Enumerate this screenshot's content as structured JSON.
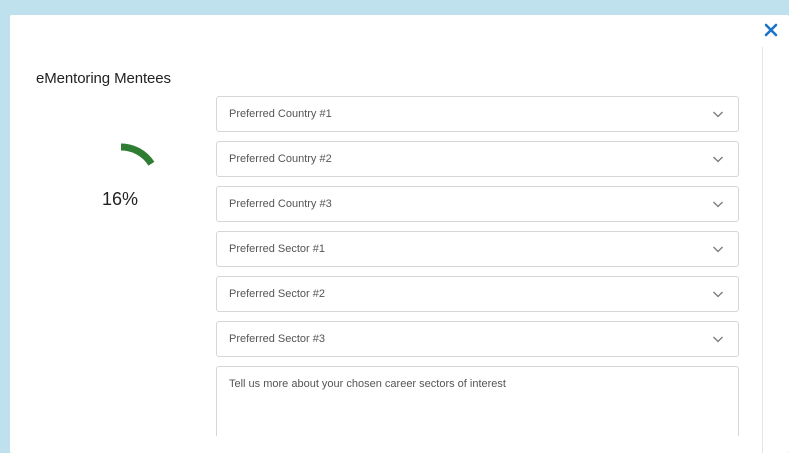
{
  "dialog": {
    "title": "eMentoring Mentees",
    "close_icon": "close-icon",
    "accent_color": "#1a73c8"
  },
  "progress": {
    "percent": 16,
    "label": "16%",
    "color": "#2e7d32"
  },
  "form": {
    "fields": [
      {
        "placeholder": "Preferred Country #1",
        "icon": "chevron-down-icon"
      },
      {
        "placeholder": "Preferred Country #2",
        "icon": "chevron-down-icon"
      },
      {
        "placeholder": "Preferred Country #3",
        "icon": "chevron-down-icon"
      },
      {
        "placeholder": "Preferred Sector #1",
        "icon": "chevron-down-icon"
      },
      {
        "placeholder": "Preferred Sector #2",
        "icon": "chevron-down-icon"
      },
      {
        "placeholder": "Preferred Sector #3",
        "icon": "chevron-down-icon"
      }
    ],
    "textarea_placeholder": "Tell us more about your chosen career sectors of interest"
  }
}
